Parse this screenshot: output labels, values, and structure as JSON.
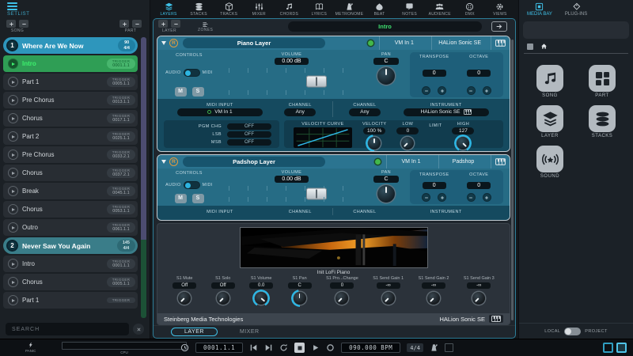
{
  "setlist": {
    "title": "SETLIST",
    "song_label": "SONG",
    "part_label": "PART",
    "trigger_label": "TRIGGER",
    "search_placeholder": "SEARCH",
    "panic_label": "PANIC",
    "cpu_label": "CPU",
    "items": [
      {
        "type": "song",
        "num": "1",
        "label": "Where Are We Now",
        "tempo": "90",
        "sig": "4/4",
        "active": true
      },
      {
        "type": "part",
        "label": "Intro",
        "trigger": "0001.1.1",
        "active": true
      },
      {
        "type": "part",
        "label": "Part 1",
        "trigger": "0005.1.1"
      },
      {
        "type": "part",
        "label": "Pre Chorus",
        "trigger": "0013.1.1"
      },
      {
        "type": "part",
        "label": "Chorus",
        "trigger": "0017.1.1"
      },
      {
        "type": "part",
        "label": "Part 2",
        "trigger": "0025.1.1"
      },
      {
        "type": "part",
        "label": "Pre Chorus",
        "trigger": "0033.2.1"
      },
      {
        "type": "part",
        "label": "Chorus",
        "trigger": "0037.2.1"
      },
      {
        "type": "part",
        "label": "Break",
        "trigger": "0045.1.1"
      },
      {
        "type": "part",
        "label": "Chorus",
        "trigger": "0053.1.1"
      },
      {
        "type": "part",
        "label": "Outro",
        "trigger": "0061.1.1"
      },
      {
        "type": "song",
        "num": "2",
        "label": "Never Saw You Again",
        "tempo": "145",
        "sig": "4/4"
      },
      {
        "type": "part",
        "label": "Intro",
        "trigger": "0001.1.1"
      },
      {
        "type": "part",
        "label": "Chorus",
        "trigger": "0005.1.1"
      },
      {
        "type": "part",
        "label": "Part 1",
        "trigger": ""
      }
    ]
  },
  "topbar": {
    "tabs": [
      {
        "label": "LAYERS",
        "icon": "layers",
        "active": true
      },
      {
        "label": "STACKS",
        "icon": "stacks"
      },
      {
        "label": "TRACKS",
        "icon": "tracks"
      },
      {
        "label": "MIXER",
        "icon": "mixer"
      },
      {
        "label": "CHORDS",
        "icon": "chords"
      },
      {
        "label": "LYRICS",
        "icon": "lyrics"
      },
      {
        "label": "METRONOME",
        "icon": "metronome"
      },
      {
        "label": "BEAT",
        "icon": "beat"
      },
      {
        "label": "NOTES",
        "icon": "notes"
      },
      {
        "label": "AUDIENCE",
        "icon": "audience"
      },
      {
        "label": "DMX",
        "icon": "dmx"
      },
      {
        "label": "VIEWS",
        "icon": "views"
      }
    ],
    "layer_label": "LAYER",
    "zones_label": "ZONES",
    "current_part": "Intro"
  },
  "piano_layer": {
    "name": "Piano Layer",
    "r_label": "R",
    "midi_in": "VM In 1",
    "instrument": "HALion Sonic SE",
    "controls_label": "CONTROLS",
    "audio_label": "AUDIO",
    "midi_label": "MIDI",
    "mute_label": "M",
    "solo_label": "S",
    "volume_label": "VOLUME",
    "volume_value": "0.00 dB",
    "pan_label": "PAN",
    "pan_value": "C",
    "transpose_label": "TRANSPOSE",
    "transpose_value": "0",
    "octave_label": "OCTAVE",
    "octave_value": "0",
    "midi_input_label": "MIDI INPUT",
    "midi_input_value": "VM In 1",
    "channel_label": "CHANNEL",
    "channel_value": "Any",
    "channel2_label": "CHANNEL",
    "channel2_value": "Any",
    "instrument_label": "INSTRUMENT",
    "instrument_value": "HALion Sonic SE",
    "pgm_chg_label": "PGM CHG",
    "pgm_chg_value": "OFF",
    "lsb_label": "LSB",
    "lsb_value": "OFF",
    "msb_label": "MSB",
    "msb_value": "OFF",
    "velocity_curve_label": "VELOCITY CURVE",
    "velocity_label": "VELOCITY",
    "velocity_value": "100 %",
    "low_label": "LOW",
    "low_value": "0",
    "limit_label": "LIMIT",
    "high_label": "HIGH",
    "high_value": "127"
  },
  "padshop_layer": {
    "name": "Padshop Layer",
    "r_label": "R",
    "midi_in": "VM In 1",
    "instrument": "Padshop",
    "controls_label": "CONTROLS",
    "audio_label": "AUDIO",
    "midi_label": "MIDI",
    "mute_label": "M",
    "solo_label": "S",
    "volume_label": "VOLUME",
    "volume_value": "0.00 dB",
    "pan_label": "PAN",
    "pan_value": "C",
    "transpose_label": "TRANSPOSE",
    "transpose_value": "0",
    "octave_label": "OCTAVE",
    "octave_value": "0",
    "midi_input_label": "MIDI INPUT",
    "channel_label": "CHANNEL",
    "channel2_label": "CHANNEL",
    "instrument_label": "INSTRUMENT"
  },
  "instrument_panel": {
    "preset_name": "Init LoFi Piano",
    "params": [
      {
        "label": "S1 Mute",
        "value": "Off",
        "rot": -135,
        "arc": "none"
      },
      {
        "label": "S1 Solo",
        "value": "Off",
        "rot": -135,
        "arc": "none"
      },
      {
        "label": "S1 Volume",
        "value": "0.0",
        "rot": 130,
        "arc": "full"
      },
      {
        "label": "S1 Pan",
        "value": "C",
        "rot": 0,
        "arc": "left"
      },
      {
        "label": "S1 Pro...Change",
        "value": "0",
        "rot": -135,
        "arc": "none"
      },
      {
        "label": "S1 Send Gain 1",
        "value": "-∞",
        "rot": -135,
        "arc": "none"
      },
      {
        "label": "S1 Send Gain 2",
        "value": "-∞",
        "rot": -135,
        "arc": "none"
      },
      {
        "label": "S1 Send Gain 3",
        "value": "-∞",
        "rot": -135,
        "arc": "none"
      }
    ],
    "vendor": "Steinberg Media Technologies",
    "plugin_name": "HALion Sonic SE"
  },
  "bottom_tabs": {
    "layer": "LAYER",
    "mixer": "MIXER"
  },
  "transport": {
    "position": "0001.1.1",
    "tempo": "090.000 BPM",
    "signature": "4/4"
  },
  "media_bay": {
    "tabs": [
      {
        "label": "MEDIA BAY",
        "icon": "mediabay",
        "active": true
      },
      {
        "label": "PLUG-INS",
        "icon": "plugins"
      }
    ],
    "browser_items": [
      {
        "label": "SONG",
        "icon": "song"
      },
      {
        "label": "PART",
        "icon": "part"
      },
      {
        "label": "LAYER",
        "icon": "layers"
      },
      {
        "label": "STACKS",
        "icon": "stacks"
      },
      {
        "label": "SOUND",
        "icon": "sound"
      }
    ],
    "local_label": "LOCAL",
    "project_label": "PROJECT"
  },
  "colors": {
    "accent": "#3fc1e8",
    "song_active": "#2e96bc",
    "part_active": "#2f9e55",
    "panel_teal": "#266c85",
    "arc_cyan": "#2cb7e5"
  }
}
